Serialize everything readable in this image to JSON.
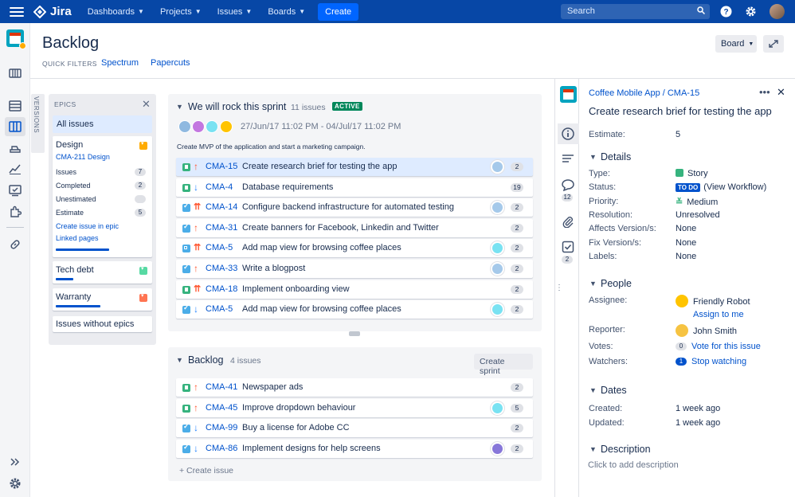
{
  "topbar": {
    "brand": "Jira",
    "nav": [
      "Dashboards",
      "Projects",
      "Issues",
      "Boards"
    ],
    "create_label": "Create",
    "search_placeholder": "Search"
  },
  "page": {
    "title": "Backlog",
    "quick_filters_label": "QUICK FILTERS",
    "quick_filters": [
      "Spectrum",
      "Papercuts"
    ],
    "board_button": "Board"
  },
  "versions_tab": "VERSIONS",
  "epics": {
    "header": "EPICS",
    "all_issues": "All issues",
    "design": {
      "name": "Design",
      "key_line": "CMA-211 Design",
      "stats": [
        {
          "label": "Issues",
          "value": "7"
        },
        {
          "label": "Completed",
          "value": "2"
        },
        {
          "label": "Unestimated",
          "value": ""
        },
        {
          "label": "Estimate",
          "value": "5"
        }
      ],
      "links": [
        "Create issue in epic",
        "Linked pages"
      ],
      "color": "#ffab00",
      "progress": 0.6
    },
    "others": [
      {
        "name": "Tech debt",
        "color": "#57d9a3",
        "progress": 0.2
      },
      {
        "name": "Warranty",
        "color": "#ff7452",
        "progress": 0.5
      }
    ],
    "without": "Issues without epics"
  },
  "sprint": {
    "name": "We will rock this sprint",
    "count": "11 issues",
    "status": "ACTIVE",
    "dates": "27/Jun/17 11:02 PM - 04/Jul/17 11:02 PM",
    "description": "Create MVP of the application and start a marketing campaign.",
    "issues": [
      {
        "type": "story",
        "priority": "high",
        "key": "CMA-15",
        "summary": "Create research brief for testing the app",
        "avatar": "robot",
        "points": "2",
        "selected": true
      },
      {
        "type": "story",
        "priority": "low",
        "key": "CMA-4",
        "summary": "Database requirements",
        "avatar": "",
        "points": "19"
      },
      {
        "type": "task",
        "priority": "highest",
        "key": "CMA-14",
        "summary": "Configure backend infrastructure for automated testing",
        "avatar": "robot",
        "points": "2"
      },
      {
        "type": "task",
        "priority": "high",
        "key": "CMA-31",
        "summary": "Create banners for Facebook, Linkedin and Twitter",
        "avatar": "",
        "points": "2"
      },
      {
        "type": "subtask",
        "priority": "highest",
        "key": "CMA-5",
        "summary": "Add map view for browsing coffee places",
        "avatar": "girl",
        "points": "2"
      },
      {
        "type": "task",
        "priority": "high",
        "key": "CMA-33",
        "summary": "Write a blogpost",
        "avatar": "robot",
        "points": "2"
      },
      {
        "type": "story",
        "priority": "highest",
        "key": "CMA-18",
        "summary": "Implement onboarding view",
        "avatar": "",
        "points": "2"
      },
      {
        "type": "task",
        "priority": "low",
        "key": "CMA-5",
        "summary": "Add map view for browsing coffee places",
        "avatar": "girl",
        "points": "2"
      }
    ]
  },
  "backlog": {
    "name": "Backlog",
    "count": "4 issues",
    "create_sprint": "Create sprint",
    "create_issue": "+ Create issue",
    "issues": [
      {
        "type": "story",
        "priority": "high",
        "key": "CMA-41",
        "summary": "Newspaper ads",
        "avatar": "",
        "points": "2"
      },
      {
        "type": "story",
        "priority": "high",
        "key": "CMA-45",
        "summary": "Improve dropdown behaviour",
        "avatar": "girl",
        "points": "5"
      },
      {
        "type": "task",
        "priority": "low",
        "key": "CMA-99",
        "summary": "Buy a license for Adobe CC",
        "avatar": "",
        "points": "2"
      },
      {
        "type": "task",
        "priority": "low",
        "key": "CMA-86",
        "summary": "Implement designs for help screens",
        "avatar": "purple",
        "points": "2"
      }
    ]
  },
  "detail": {
    "breadcrumb": "Coffee Mobile App / CMA-15",
    "title": "Create research brief for testing the app",
    "estimate_label": "Estimate:",
    "estimate": "5",
    "comments_count": "12",
    "checklist_count": "2",
    "details_header": "Details",
    "details": {
      "type_label": "Type:",
      "type": "Story",
      "status_label": "Status:",
      "status_badge": "TO DO",
      "status_link": "(View Workflow)",
      "priority_label": "Priority:",
      "priority": "Medium",
      "resolution_label": "Resolution:",
      "resolution": "Unresolved",
      "affects_label": "Affects Version/s:",
      "affects": "None",
      "fix_label": "Fix Version/s:",
      "fix": "None",
      "labels_label": "Labels:",
      "labels": "None"
    },
    "people_header": "People",
    "people": {
      "assignee_label": "Assignee:",
      "assignee": "Friendly Robot",
      "assign_me": "Assign to me",
      "reporter_label": "Reporter:",
      "reporter": "John Smith",
      "votes_label": "Votes:",
      "votes": "0",
      "vote_link": "Vote for this issue",
      "watchers_label": "Watchers:",
      "watchers": "1",
      "watch_link": "Stop watching"
    },
    "dates_header": "Dates",
    "dates": {
      "created_label": "Created:",
      "created": "1 week ago",
      "updated_label": "Updated:",
      "updated": "1 week ago"
    },
    "description_header": "Description",
    "description_placeholder": "Click to add description"
  },
  "colors": {
    "topbar": "#0747a6",
    "link": "#0052cc",
    "story": "#36b37e",
    "task": "#4bade8",
    "subtask": "#4bade8",
    "high": "#ff5630",
    "low": "#2684ff",
    "medium": "#36b37e"
  }
}
